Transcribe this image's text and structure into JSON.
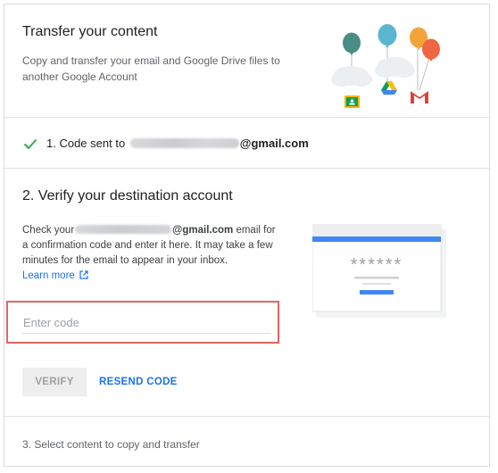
{
  "header": {
    "title": "Transfer your content",
    "subtitle": "Copy and transfer your email and Google Drive files to another Google Account"
  },
  "step1": {
    "label_prefix": "1. Code sent to",
    "email_domain": "@gmail.com",
    "status_icon": "check-icon"
  },
  "step2": {
    "title": "2. Verify your destination account",
    "instr_prefix": "Check your",
    "email_domain": "@gmail.com",
    "instr_suffix": " email for a confirmation code and enter it here. It may take a few minutes for the email to appear in your inbox.",
    "learn_more": "Learn more",
    "code_placeholder": "Enter code",
    "code_value": "",
    "verify_label": "VERIFY",
    "resend_label": "RESEND CODE",
    "mock_masked": "******"
  },
  "step3": {
    "label": "3. Select content to copy and transfer"
  },
  "colors": {
    "accent": "#1a73e8",
    "check": "#34a853",
    "highlight_border": "#e06666"
  }
}
